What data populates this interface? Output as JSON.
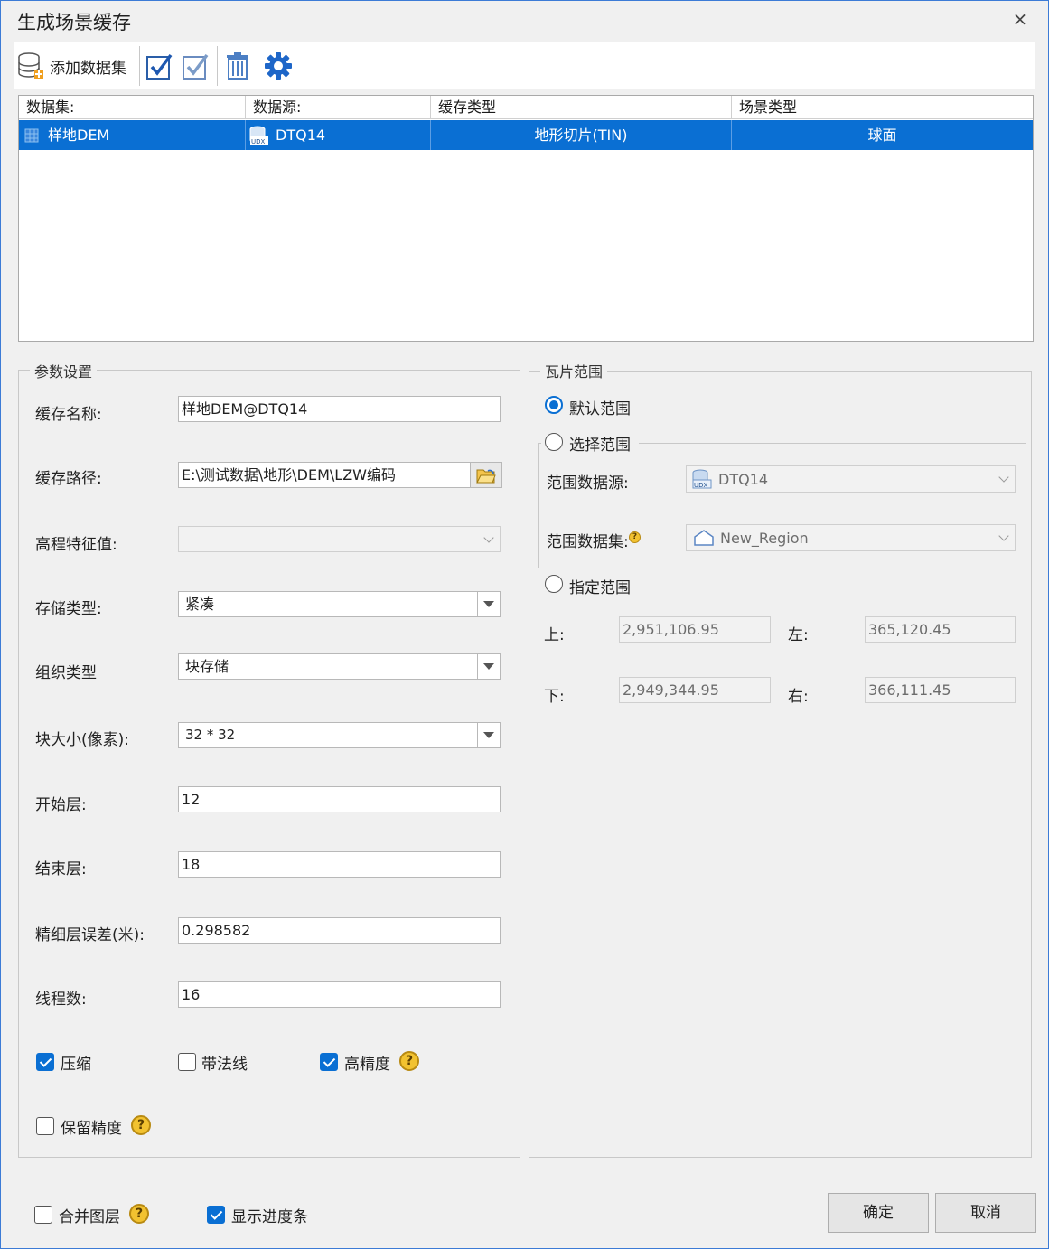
{
  "window": {
    "title": "生成场景缓存",
    "close": "×"
  },
  "toolbar": {
    "add_dataset": "添加数据集"
  },
  "grid": {
    "headers": [
      "数据集:",
      "数据源:",
      "缓存类型",
      "场景类型"
    ],
    "rows": [
      {
        "dataset": "样地DEM",
        "datasource": "DTQ14",
        "cache_type": "地形切片(TIN)",
        "scene_type": "球面"
      }
    ]
  },
  "params": {
    "group_title": "参数设置",
    "cache_name_label": "缓存名称:",
    "cache_name": "样地DEM@DTQ14",
    "cache_path_label": "缓存路径:",
    "cache_path": "E:\\测试数据\\地形\\DEM\\LZW编码",
    "elevation_label": "高程特征值:",
    "elevation": "",
    "storage_label": "存储类型:",
    "storage": "紧凑",
    "org_label": "组织类型",
    "org": "块存储",
    "block_label": "块大小(像素):",
    "block": "32 * 32",
    "start_label": "开始层:",
    "start": "12",
    "end_label": "结束层:",
    "end": "18",
    "lod_error_label": "精细层误差(米):",
    "lod_error": "0.298582",
    "threads_label": "线程数:",
    "threads": "16",
    "compress_label": "压缩",
    "compress": true,
    "normal_label": "带法线",
    "normal": false,
    "hp_label": "高精度",
    "hp": true,
    "keep_label": "保留精度",
    "keep": false,
    "help": "?"
  },
  "tile_range": {
    "group_title": "瓦片范围",
    "default_label": "默认范围",
    "select_label": "选择范围",
    "range_ds_label": "范围数据源:",
    "range_ds": "DTQ14",
    "range_dataset_label": "范围数据集:",
    "range_dataset": "New_Region",
    "specify_label": "指定范围",
    "top_label": "上:",
    "top": "2,951,106.95",
    "left_label": "左:",
    "left": "365,120.45",
    "bottom_label": "下:",
    "bottom": "2,949,344.95",
    "right_label": "右:",
    "right": "366,111.45",
    "selected": "default"
  },
  "footer": {
    "merge_label": "合并图层",
    "merge": false,
    "progress_label": "显示进度条",
    "progress": true,
    "ok": "确定",
    "cancel": "取消"
  },
  "colors": {
    "accent": "#0a6fd3",
    "border": "#3c7bd6"
  }
}
